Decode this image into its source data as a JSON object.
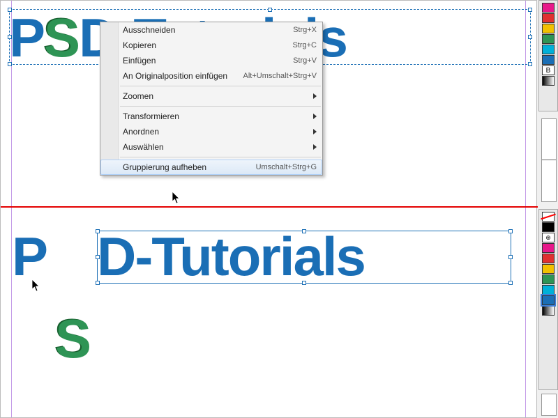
{
  "canvas": {
    "top_text": {
      "before_s": "P",
      "s": "S",
      "after_s": "D-Tutorials"
    },
    "bottom_text": {
      "p": "P",
      "s": "S",
      "rest": "D-Tutorials"
    }
  },
  "context_menu": {
    "items": [
      {
        "label": "Ausschneiden",
        "shortcut": "Strg+X",
        "type": "item"
      },
      {
        "label": "Kopieren",
        "shortcut": "Strg+C",
        "type": "item"
      },
      {
        "label": "Einfügen",
        "shortcut": "Strg+V",
        "type": "item"
      },
      {
        "label": "An Originalposition einfügen",
        "shortcut": "Alt+Umschalt+Strg+V",
        "type": "item"
      },
      {
        "type": "separator"
      },
      {
        "label": "Zoomen",
        "type": "submenu"
      },
      {
        "type": "separator"
      },
      {
        "label": "Transformieren",
        "type": "submenu"
      },
      {
        "label": "Anordnen",
        "type": "submenu"
      },
      {
        "label": "Auswählen",
        "type": "submenu"
      },
      {
        "type": "separator"
      },
      {
        "label": "Gruppierung aufheben",
        "shortcut": "Umschalt+Strg+G",
        "type": "item",
        "hover": true
      }
    ]
  },
  "swatches": {
    "top": [
      {
        "color": "#e8188a"
      },
      {
        "color": "#e03030"
      },
      {
        "color": "#f2c000"
      },
      {
        "color": "#2e9455"
      },
      {
        "color": "#00b0d8"
      },
      {
        "color": "#1a6eb5"
      },
      {
        "label_b": "B"
      },
      {
        "gradient": true
      }
    ],
    "bottom": [
      {
        "none": true
      },
      {
        "color": "#000000"
      },
      {
        "registration": true
      },
      {
        "color": "#e8188a"
      },
      {
        "color": "#e03030"
      },
      {
        "color": "#f2c000"
      },
      {
        "color": "#2e9455"
      },
      {
        "color": "#00b0d8"
      },
      {
        "color": "#1a6eb5",
        "selected": true
      },
      {
        "gradient": true
      }
    ]
  }
}
